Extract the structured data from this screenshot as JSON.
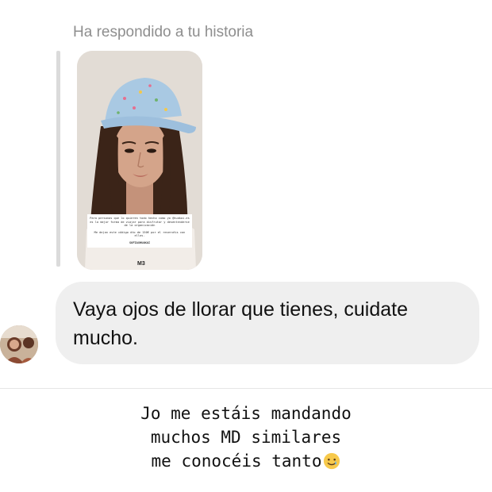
{
  "reply_header": "Ha respondido a tu historia",
  "story": {
    "caption_paragraph_1": "Para personas que lo quieren todo hecho como yo @huakai.es es la mejor forma de viajar para disfrutar y desentenderse de la organización",
    "caption_paragraph_2": "Me dejan este código dto de 150€ por el reservéis con ellos.",
    "discount_code": "SOFIAXHUAKAI",
    "brand_text": "M3"
  },
  "message": {
    "text": "Vaya ojos de llorar que tienes, cuidate mucho."
  },
  "caption": {
    "line1": "Jo me estáis mandando",
    "line2": "muchos MD similares",
    "line3": "me conocéis tanto",
    "emoji": "smiling-face-with-tear-icon"
  },
  "colors": {
    "bubble": "#efefef",
    "header_text": "#8e8e8e",
    "quote_bar": "#dbdbdb"
  }
}
